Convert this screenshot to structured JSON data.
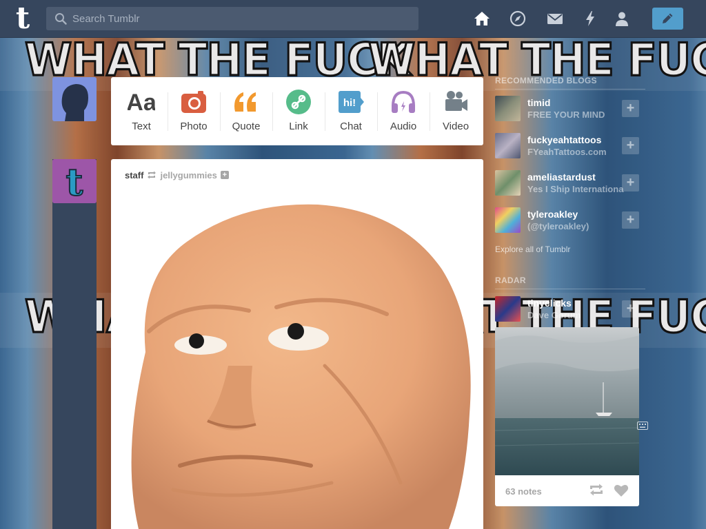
{
  "background": {
    "banner_text": "WHAT THE FUCK"
  },
  "header": {
    "search_placeholder": "Search Tumblr",
    "colors": {
      "bar": "#36465d",
      "compose": "#529ecc"
    },
    "nav_icons": [
      "home-icon",
      "explore-compass-icon",
      "messages-envelope-icon",
      "activity-lightning-icon",
      "account-person-icon"
    ]
  },
  "post_bar": {
    "types": [
      {
        "label": "Text",
        "icon": "text-icon",
        "color": "#444444"
      },
      {
        "label": "Photo",
        "icon": "camera-icon",
        "color": "#d95e40"
      },
      {
        "label": "Quote",
        "icon": "quote-icon",
        "color": "#f2992e"
      },
      {
        "label": "Link",
        "icon": "link-icon",
        "color": "#56bc8a"
      },
      {
        "label": "Chat",
        "icon": "chat-icon",
        "color": "#529ecc"
      },
      {
        "label": "Audio",
        "icon": "headphones-icon",
        "color": "#a77dc2"
      },
      {
        "label": "Video",
        "icon": "video-camera-icon",
        "color": "#748089"
      }
    ]
  },
  "post": {
    "author": "staff",
    "reblogged_from": "jellygummies"
  },
  "sidebar": {
    "recommended_heading": "RECOMMENDED BLOGS",
    "blogs": [
      {
        "name": "timid",
        "subtitle": "FREE YOUR MIND"
      },
      {
        "name": "fuckyeahtattoos",
        "subtitle": "FYeahTattoos.com"
      },
      {
        "name": "ameliastardust",
        "subtitle": "Yes I Ship International"
      },
      {
        "name": "tyleroakley",
        "subtitle": "(@tyleroakley)"
      }
    ],
    "follow_symbol": "+",
    "explore_link": "Explore all of Tumblr",
    "radar_heading": "RADAR",
    "radar": {
      "name": "tinyclicks",
      "subtitle": "Dave Gorum",
      "notes": "63 notes"
    }
  }
}
